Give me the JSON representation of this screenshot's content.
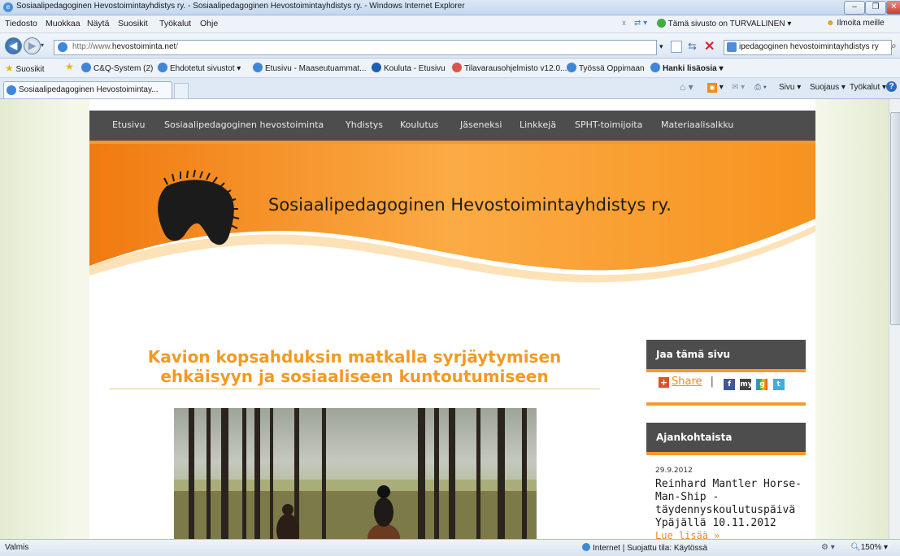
{
  "window": {
    "title": "Sosiaalipedagoginen Hevostoimintayhdistys ry. - Sosiaalipedagoginen Hevostoimintayhdistys ry. - Windows Internet Explorer"
  },
  "menubar": {
    "items": [
      "Tiedosto",
      "Muokkaa",
      "Näytä",
      "Suosikit",
      "Työkalut",
      "Ohje"
    ],
    "security_text": "Tämä sivusto on TURVALLINEN",
    "report_text": "Ilmoita meille"
  },
  "address": {
    "prefix": "http://www.",
    "domain": "hevostoiminta.net",
    "suffix": "/",
    "search_value": "ipedagoginen hevostoimintayhdistys ry"
  },
  "favorites": {
    "label": "Suosikit",
    "items": [
      "C&Q-System (2)",
      "Ehdotetut sivustot",
      "Etusivu - Maaseutuammat...",
      "Kouluta - Etusivu",
      "Tilavarausohjelmisto v12.0...",
      "Työssä Oppimaan",
      "Hanki lisäosia"
    ]
  },
  "tabs": {
    "active": "Sosiaalipedagoginen Hevostoimintay...",
    "tools": [
      "Sivu",
      "Suojaus",
      "Työkalut"
    ]
  },
  "site": {
    "nav": [
      "Etusivu",
      "Sosiaalipedagoginen hevostoiminta",
      "Yhdistys",
      "Koulutus",
      "Jäseneksi",
      "Linkkejä",
      "SPHT-toimijoita",
      "Materiaalisalkku"
    ],
    "title": "Sosiaalipedagoginen Hevostoimintayhdistys ry.",
    "headline": "Kavion kopsahduksin matkalla syrjäytymisen ehkäisyyn ja sosiaaliseen kuntoutumiseen",
    "share_box": {
      "heading": "Jaa tämä sivu",
      "share_label": "Share",
      "separator": "|"
    },
    "news_box": {
      "heading": "Ajankohtaista",
      "date": "29.9.2012",
      "title": "Reinhard Mantler Horse-Man-Ship -täydennyskoulutuspäivä Ypäjällä 10.11.2012",
      "read_more": "Lue lisää »"
    }
  },
  "status": {
    "left": "Valmis",
    "zone": "Internet | Suojattu tila: Käytössä",
    "zoom": "150%"
  },
  "colors": {
    "accent_orange": "#f59a2a",
    "nav_gray": "#4d4d4d",
    "headline_orange": "#f39a21"
  }
}
